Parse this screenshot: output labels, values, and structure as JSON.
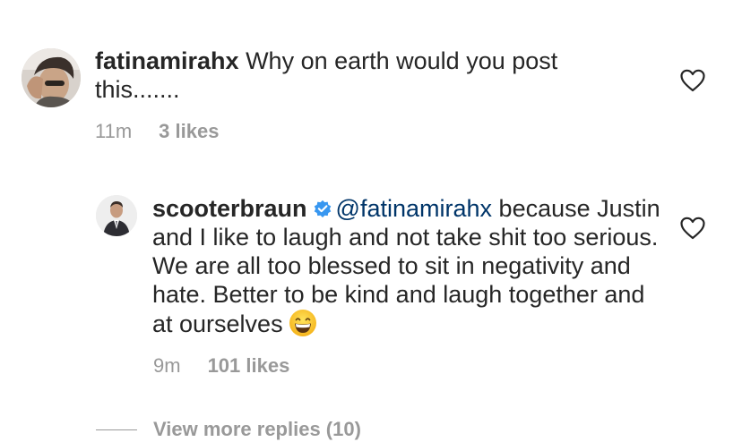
{
  "comments": [
    {
      "username": "fatinamirahx",
      "text": "Why on earth would you post this.......",
      "time": "11m",
      "likes": "3 likes",
      "liked": false
    },
    {
      "username": "scooterbraun",
      "verified": true,
      "mention": "@fatinamirahx",
      "text": "because Justin and I like to laugh and not take shit too serious. We are all too blessed to sit in negativity and hate. Better to be kind and laugh together and at ourselves",
      "emoji": "grinning-face-with-smiling-eyes",
      "time": "9m",
      "likes": "101 likes",
      "liked": false
    }
  ],
  "view_more_replies": "View more replies (10)",
  "icons": {
    "like": "heart-outline-icon",
    "verified": "verified-badge-icon"
  },
  "colors": {
    "text": "#262626",
    "secondary": "#999999",
    "mention": "#003569",
    "verified": "#3897f0"
  }
}
